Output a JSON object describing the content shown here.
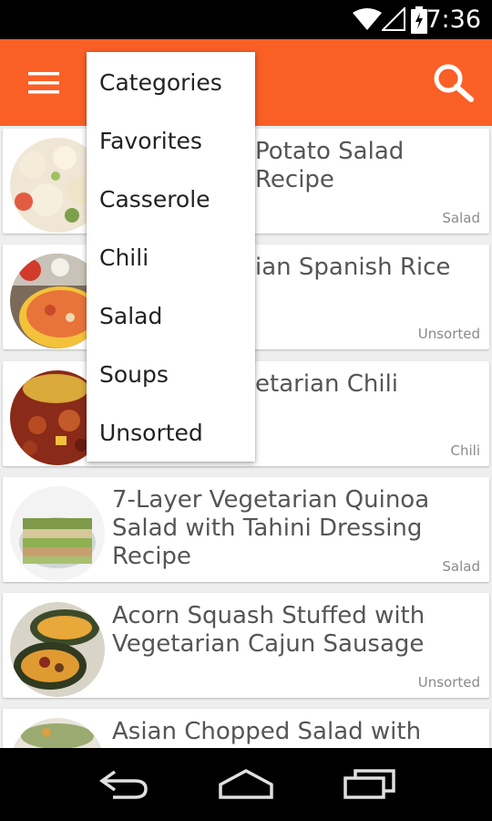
{
  "status_bar": {
    "time": "7:36"
  },
  "dropdown": {
    "items": [
      "Categories",
      "Favorites",
      "Casserole",
      "Chili",
      "Salad",
      "Soups",
      "Unsorted"
    ]
  },
  "recipes": [
    {
      "title": "Potato Salad Recipe",
      "category": "Salad"
    },
    {
      "title": "ian Spanish Rice",
      "category": "Unsorted"
    },
    {
      "title": "etarian Chili",
      "category": "Chili"
    },
    {
      "title": "7-Layer Vegetarian Quinoa Salad with Tahini Dressing Recipe",
      "category": "Salad"
    },
    {
      "title": "Acorn Squash Stuffed with Vegetarian Cajun Sausage",
      "category": "Unsorted"
    },
    {
      "title": "Asian Chopped Salad with",
      "category": ""
    }
  ],
  "colors": {
    "app_bar": "#fa5f26",
    "status_bar": "#000000"
  }
}
